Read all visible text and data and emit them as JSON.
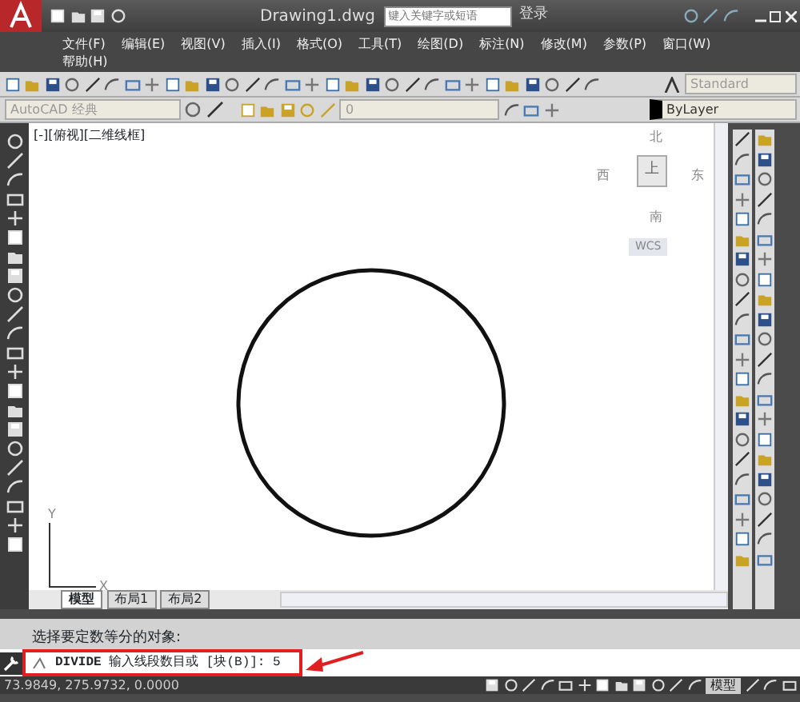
{
  "window": {
    "title": "Drawing1.dwg",
    "search": {
      "placeholder": "键入关键字或短语"
    },
    "login": "登录"
  },
  "menu": [
    "文件(F)",
    "编辑(E)",
    "视图(V)",
    "插入(I)",
    "格式(O)",
    "工具(T)",
    "绘图(D)",
    "标注(N)",
    "修改(M)",
    "参数(P)",
    "窗口(W)",
    "帮助(H)"
  ],
  "toolbars": {
    "text_style": "Standard",
    "workspace": "AutoCAD 经典",
    "layer": "0",
    "color_dropdown": "ByLayer"
  },
  "viewport": {
    "label": "[-][俯视][二维线框]"
  },
  "viewcube": {
    "north": "北",
    "south": "南",
    "east": "东",
    "west": "西",
    "top": "上",
    "wcs": "WCS"
  },
  "ucs": {
    "x": "X",
    "y": "Y"
  },
  "layout_tabs": [
    {
      "label": "模型",
      "selected": true
    },
    {
      "label": "布局1",
      "selected": false
    },
    {
      "label": "布局2",
      "selected": false
    }
  ],
  "command": {
    "history": "选择要定数等分的对象:",
    "name": "DIVIDE",
    "prompt": "输入线段数目或",
    "option": "[块(B)]:",
    "value": "5"
  },
  "status_bar": {
    "coordinates": "73.9849, 275.9732, 0.0000",
    "model": "模型"
  }
}
